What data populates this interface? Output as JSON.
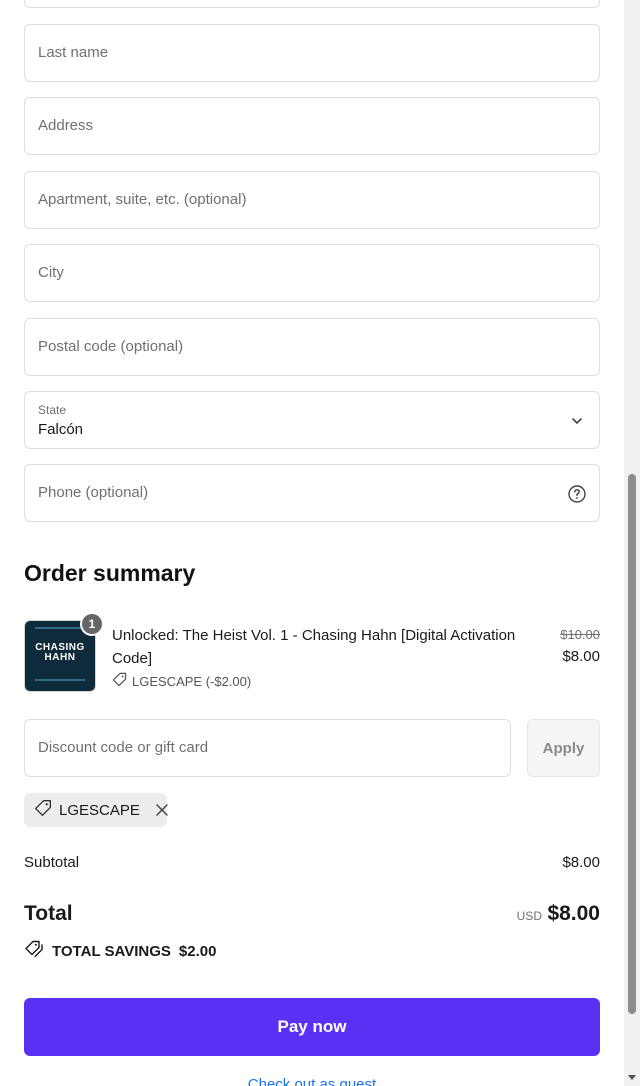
{
  "form": {
    "fields": [
      {
        "placeholder": "Last name"
      },
      {
        "placeholder": "Address"
      },
      {
        "placeholder": "Apartment, suite, etc. (optional)"
      },
      {
        "placeholder": "City"
      },
      {
        "placeholder": "Postal code (optional)"
      }
    ],
    "state": {
      "label": "State",
      "value": "Falcón"
    },
    "phone": {
      "placeholder": "Phone (optional)"
    }
  },
  "summary": {
    "title": "Order summary",
    "item": {
      "quantity": "1",
      "thumb_text_line1": "CHASING",
      "thumb_text_line2": "HAHN",
      "name": "Unlocked: The Heist Vol. 1 - Chasing Hahn [Digital Activation Code]",
      "discount_label": "LGESCAPE (-$2.00)",
      "price_original": "$10.00",
      "price_final": "$8.00"
    },
    "discount_input": {
      "placeholder": "Discount code or gift card"
    },
    "apply_label": "Apply",
    "applied_code": "LGESCAPE",
    "subtotal_label": "Subtotal",
    "subtotal_value": "$8.00",
    "total_label": "Total",
    "total_currency": "USD",
    "total_value": "$8.00",
    "savings_label": "TOTAL SAVINGS",
    "savings_value": "$2.00"
  },
  "actions": {
    "pay_label": "Pay now",
    "guest_label": "Check out as guest"
  },
  "colors": {
    "pay_button": "#5a31f4",
    "link": "#1a73e8"
  }
}
